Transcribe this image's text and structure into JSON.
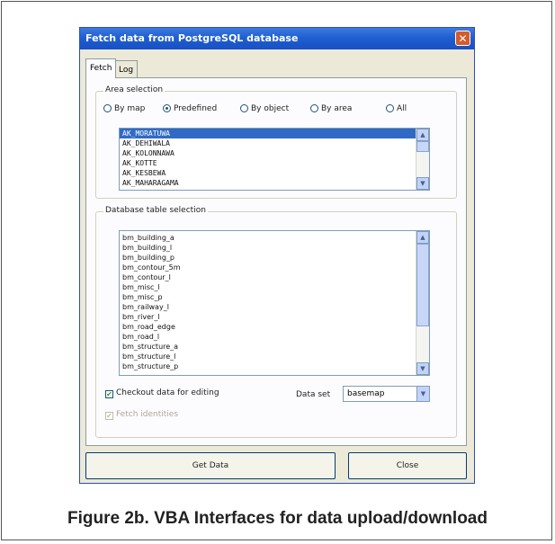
{
  "window": {
    "title": "Fetch data from PostgreSQL  database",
    "close_glyph": "✕",
    "tabs": [
      {
        "label": "Fetch",
        "active": true
      },
      {
        "label": "Log",
        "active": false
      }
    ]
  },
  "area_selection": {
    "legend": "Area selection",
    "radios": [
      {
        "label": "By map",
        "selected": false
      },
      {
        "label": "Predefined",
        "selected": true
      },
      {
        "label": "By object",
        "selected": false
      },
      {
        "label": "By area",
        "selected": false
      },
      {
        "label": "All",
        "selected": false
      }
    ],
    "areas": [
      "AK_MORATUWA",
      "AK_DEHIWALA",
      "AK_KOLONNAWA",
      "AK_KOTTE",
      "AK_KESBEWA",
      "AK_MAHARAGAMA"
    ],
    "selected_area": "AK_MORATUWA"
  },
  "table_selection": {
    "legend": "Database table selection",
    "tables": [
      "bm_building_a",
      "bm_building_l",
      "bm_building_p",
      "bm_contour_5m",
      "bm_contour_l",
      "bm_misc_l",
      "bm_misc_p",
      "bm_railway_l",
      "bm_river_l",
      "bm_road_edge",
      "bm_road_l",
      "bm_structure_a",
      "bm_structure_l",
      "bm_structure_p"
    ],
    "checkout_label": "Checkout data for editing",
    "checkout_checked": true,
    "fetch_label": "Fetch identities",
    "fetch_checked": true,
    "fetch_enabled": false,
    "dataset_label": "Data set",
    "dataset_value": "basemap"
  },
  "buttons": {
    "get_data": "Get Data",
    "close": "Close"
  },
  "icons": {
    "scroll_up": "▲",
    "scroll_down": "▼",
    "dropdown": "▼",
    "check": "✔"
  },
  "caption": "Figure 2b. VBA Interfaces for data upload/download",
  "colors": {
    "titlebar": "#1f5fd1",
    "selection": "#316ac5",
    "close_button": "#d75a2b",
    "window_face": "#ece9d8"
  }
}
